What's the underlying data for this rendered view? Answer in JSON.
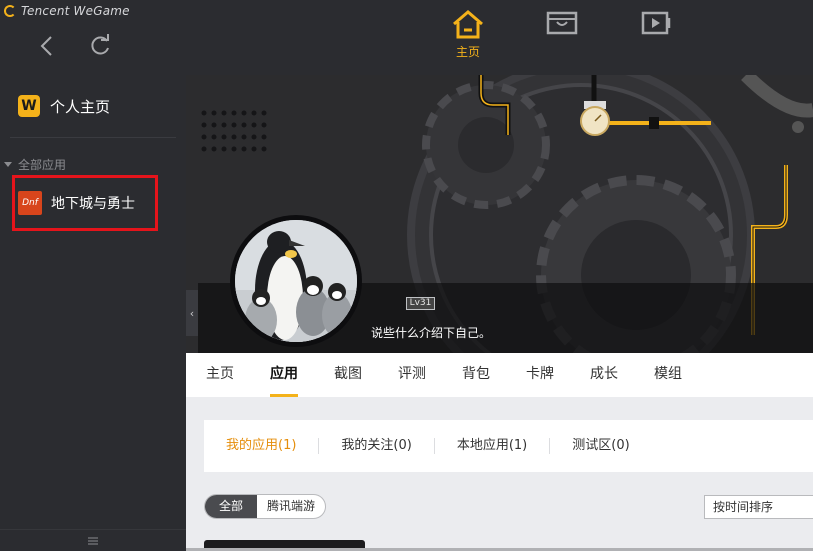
{
  "app": {
    "brand": "Tencent WeGame"
  },
  "nav": {
    "home_label": "主页",
    "store_icon": "store-icon",
    "video_icon": "video-icon"
  },
  "sidebar": {
    "profile_label": "个人主页",
    "section_label": "全部应用",
    "items": [
      {
        "label": "地下城与勇士",
        "icon_text": "Dnf"
      }
    ]
  },
  "profile": {
    "level": "Lv31",
    "bio": "说些什么介绍下自己。"
  },
  "tabs": [
    {
      "label": "主页"
    },
    {
      "label": "应用"
    },
    {
      "label": "截图"
    },
    {
      "label": "评测"
    },
    {
      "label": "背包"
    },
    {
      "label": "卡牌"
    },
    {
      "label": "成长"
    },
    {
      "label": "模组"
    }
  ],
  "subtabs": [
    {
      "label": "我的应用(1)"
    },
    {
      "label": "我的关注(0)"
    },
    {
      "label": "本地应用(1)"
    },
    {
      "label": "测试区(0)"
    }
  ],
  "filters": [
    {
      "label": "全部"
    },
    {
      "label": "腾讯端游"
    }
  ],
  "sort": {
    "label": "按时间排序"
  },
  "colors": {
    "accent": "#f4b21a",
    "highlight_border": "#e5141b",
    "active_subtab": "#e58e0b"
  }
}
